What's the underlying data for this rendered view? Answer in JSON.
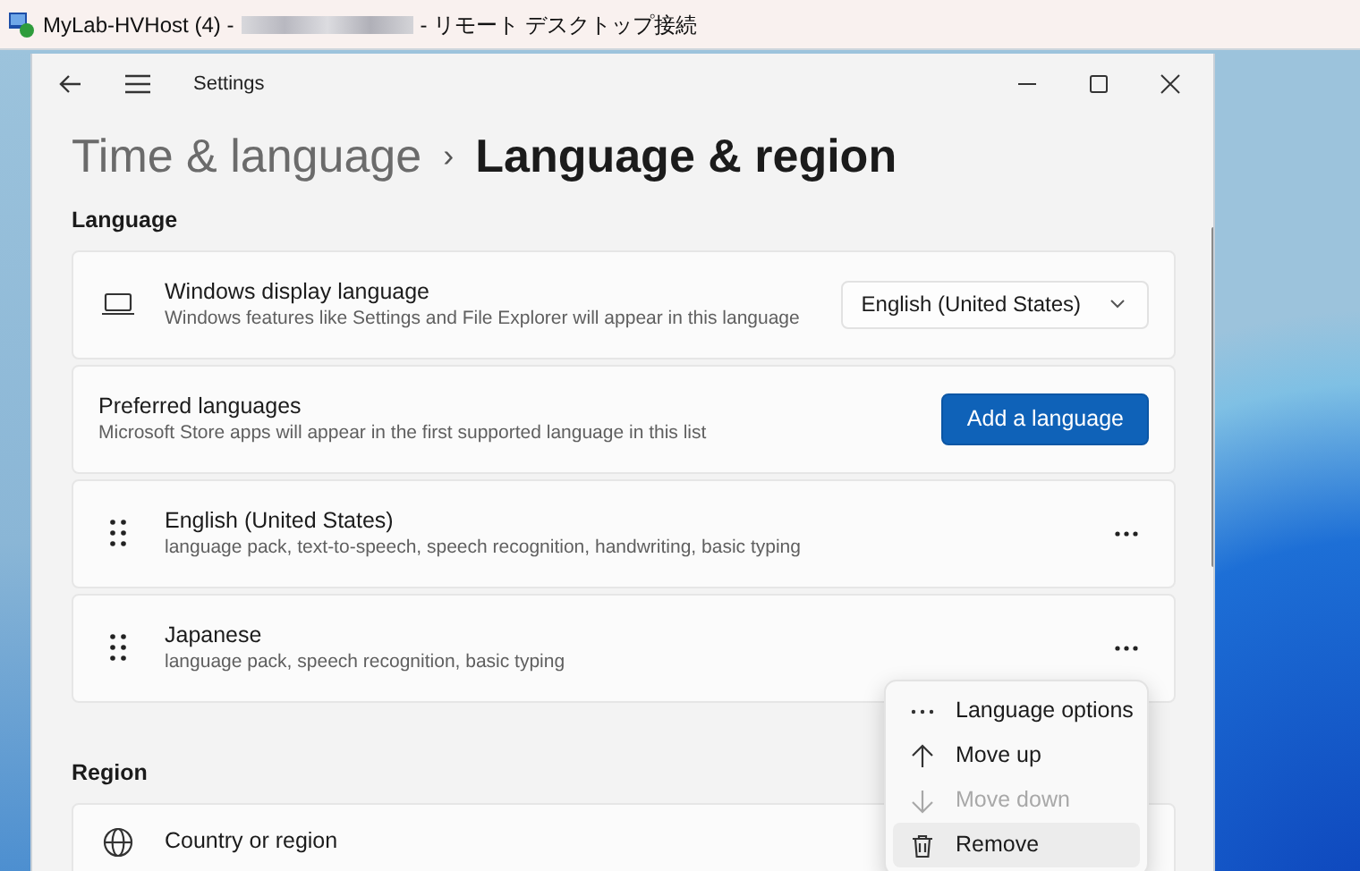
{
  "remote_window": {
    "title": "MyLab-HVHost (4) -",
    "title_suffix": "- リモート デスクトップ接続"
  },
  "settings": {
    "app_title": "Settings",
    "breadcrumb": [
      {
        "label": "Time & language",
        "current": false
      },
      {
        "label": "Language & region",
        "current": true
      }
    ],
    "breadcrumb_separator": "›",
    "sections": [
      {
        "heading": "Language",
        "cards": [
          {
            "kind": "dropdown",
            "title": "Windows display language",
            "description": "Windows features like Settings and File Explorer will appear in this language",
            "value": "English (United States)"
          },
          {
            "kind": "action",
            "title": "Preferred languages",
            "description": "Microsoft Store apps will appear in the first supported language in this list",
            "button": "Add a language"
          },
          {
            "kind": "language",
            "title": "English (United States)",
            "description": "language pack, text-to-speech, speech recognition, handwriting, basic typing"
          },
          {
            "kind": "language",
            "title": "Japanese",
            "description": "language pack, speech recognition, basic typing"
          }
        ]
      },
      {
        "heading": "Region",
        "cards": [
          {
            "kind": "setting",
            "title": "Country or region"
          }
        ]
      }
    ]
  },
  "context_menu": {
    "items": [
      {
        "kind": "options",
        "label": "Language options",
        "disabled": false,
        "hovered": false
      },
      {
        "kind": "up",
        "label": "Move up",
        "disabled": false,
        "hovered": false
      },
      {
        "kind": "down",
        "label": "Move down",
        "disabled": true,
        "hovered": false
      },
      {
        "kind": "remove",
        "label": "Remove",
        "disabled": false,
        "hovered": true
      }
    ]
  }
}
